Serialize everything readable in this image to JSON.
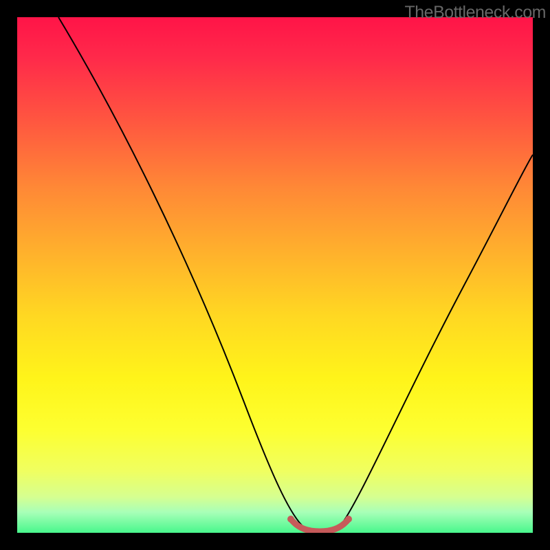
{
  "watermark": "TheBottleneck.com",
  "chart_data": {
    "type": "line",
    "title": "",
    "xlabel": "",
    "ylabel": "",
    "xlim": [
      0,
      100
    ],
    "ylim": [
      0,
      100
    ],
    "series": [
      {
        "name": "main-curve",
        "x": [
          8,
          20,
          30,
          40,
          48,
          52,
          55,
          58,
          60,
          62,
          70,
          80,
          90,
          100
        ],
        "y": [
          100,
          80,
          62,
          43,
          24,
          10,
          2,
          0,
          0,
          2,
          14,
          30,
          46,
          62
        ]
      },
      {
        "name": "highlight-red",
        "x": [
          52,
          55,
          58,
          60,
          62,
          64
        ],
        "y": [
          2,
          0.5,
          0,
          0,
          0.5,
          2
        ]
      }
    ],
    "gradient": [
      "#ff1448",
      "#ffb22c",
      "#fff41a",
      "#48f78c"
    ],
    "highlight_color": "#c86464"
  }
}
